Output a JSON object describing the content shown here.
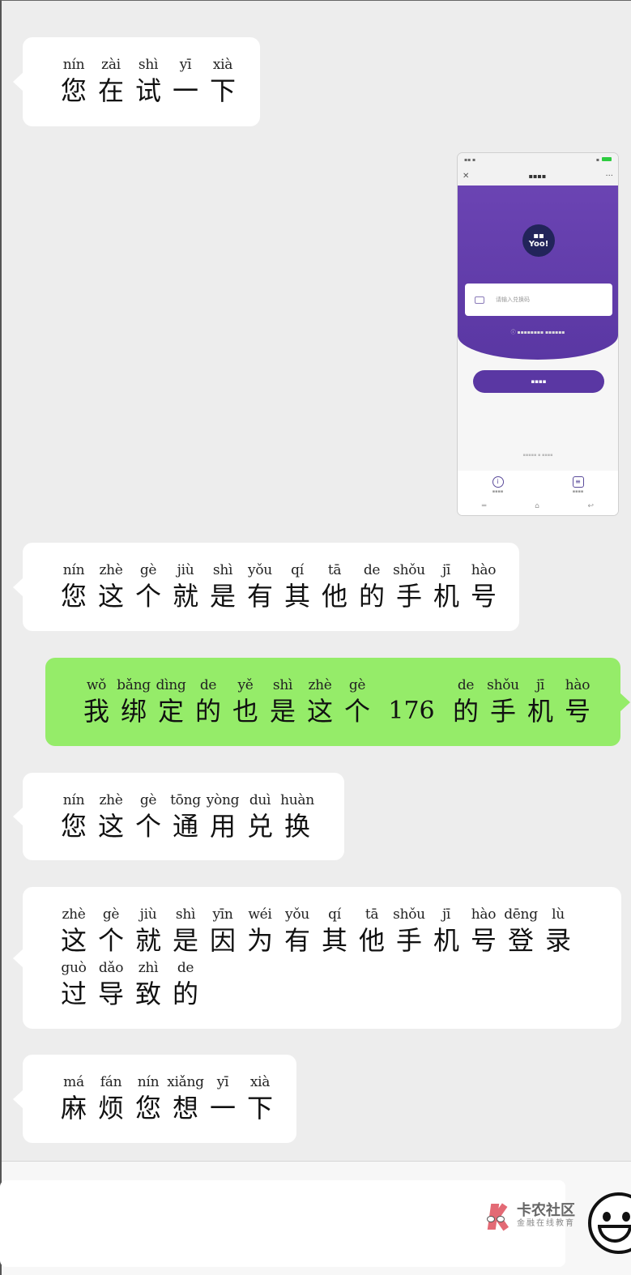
{
  "messages": [
    {
      "side": "left",
      "lines": [
        [
          [
            "nín",
            "您"
          ],
          [
            "zài",
            "在"
          ],
          [
            "shì",
            "试"
          ],
          [
            "yī",
            "一"
          ],
          [
            "xià",
            "下"
          ]
        ]
      ]
    },
    {
      "side": "right",
      "type": "image",
      "image": {
        "description": "screenshot of a purple redemption page",
        "logo_text": "Yoo!",
        "close_glyph": "✕",
        "more_glyph": "···",
        "input_placeholder": "请输入兑换码",
        "nav_glyphs": [
          "═",
          "⌂",
          "↩"
        ],
        "tab_glyphs": [
          "i",
          "≡"
        ],
        "theme_color": "#5a37a3"
      }
    },
    {
      "side": "left",
      "lines": [
        [
          [
            "nín",
            "您"
          ],
          [
            "zhè",
            "这"
          ],
          [
            "gè",
            "个"
          ],
          [
            "jiù",
            "就"
          ],
          [
            "shì",
            "是"
          ],
          [
            "yǒu",
            "有"
          ],
          [
            "qí",
            "其"
          ],
          [
            "tā",
            "他"
          ],
          [
            "de",
            "的"
          ],
          [
            "shǒu",
            "手"
          ],
          [
            "jī",
            "机"
          ],
          [
            "hào",
            "号"
          ]
        ]
      ]
    },
    {
      "side": "right",
      "lines": [
        [
          [
            "wǒ",
            "我"
          ],
          [
            "bǎng",
            "绑"
          ],
          [
            "dìng",
            "定"
          ],
          [
            "de",
            "的"
          ],
          [
            "yě",
            "也"
          ],
          [
            "shì",
            "是"
          ],
          [
            "zhè",
            "这"
          ],
          [
            "gè",
            "个"
          ],
          [
            "",
            "176"
          ],
          [
            "de",
            "的"
          ],
          [
            "shǒu",
            "手"
          ],
          [
            "jī",
            "机"
          ],
          [
            "hào",
            "号"
          ]
        ]
      ]
    },
    {
      "side": "left",
      "lines": [
        [
          [
            "nín",
            "您"
          ],
          [
            "zhè",
            "这"
          ],
          [
            "gè",
            "个"
          ],
          [
            "tōng",
            "通"
          ],
          [
            "yòng",
            "用"
          ],
          [
            "duì",
            "兑"
          ],
          [
            "huàn",
            "换"
          ]
        ]
      ]
    },
    {
      "side": "left",
      "lines": [
        [
          [
            "zhè",
            "这"
          ],
          [
            "gè",
            "个"
          ],
          [
            "jiù",
            "就"
          ],
          [
            "shì",
            "是"
          ],
          [
            "yīn",
            "因"
          ],
          [
            "wéi",
            "为"
          ],
          [
            "yǒu",
            "有"
          ],
          [
            "qí",
            "其"
          ],
          [
            "tā",
            "他"
          ],
          [
            "shǒu",
            "手"
          ],
          [
            "jī",
            "机"
          ],
          [
            "hào",
            "号"
          ],
          [
            "dēng",
            "登"
          ],
          [
            "lù",
            "录"
          ]
        ],
        [
          [
            "guò",
            "过"
          ],
          [
            "dǎo",
            "导"
          ],
          [
            "zhì",
            "致"
          ],
          [
            "de",
            "的"
          ]
        ]
      ]
    },
    {
      "side": "left",
      "lines": [
        [
          [
            "má",
            "麻"
          ],
          [
            "fán",
            "烦"
          ],
          [
            "nín",
            "您"
          ],
          [
            "xiǎng",
            "想"
          ],
          [
            "yī",
            "一"
          ],
          [
            "xià",
            "下"
          ]
        ]
      ]
    }
  ],
  "message_text": [
    "您在试一下",
    "[图片]",
    "您这个就是有其他的手机号",
    "我绑定的也是这个176的手机号",
    "您这个通用兑换",
    "这个就是因为有其他手机号登录过导致的",
    "麻烦您想一下"
  ],
  "input_bar": {
    "text_value": "",
    "emoji_button": "smiley-icon"
  },
  "watermark": {
    "title": "卡农社区",
    "subtitle": "金融在线教育",
    "color": "#e36a75"
  },
  "colors": {
    "background": "#ededed",
    "incoming_bubble": "#ffffff",
    "outgoing_bubble": "#95ec69"
  }
}
